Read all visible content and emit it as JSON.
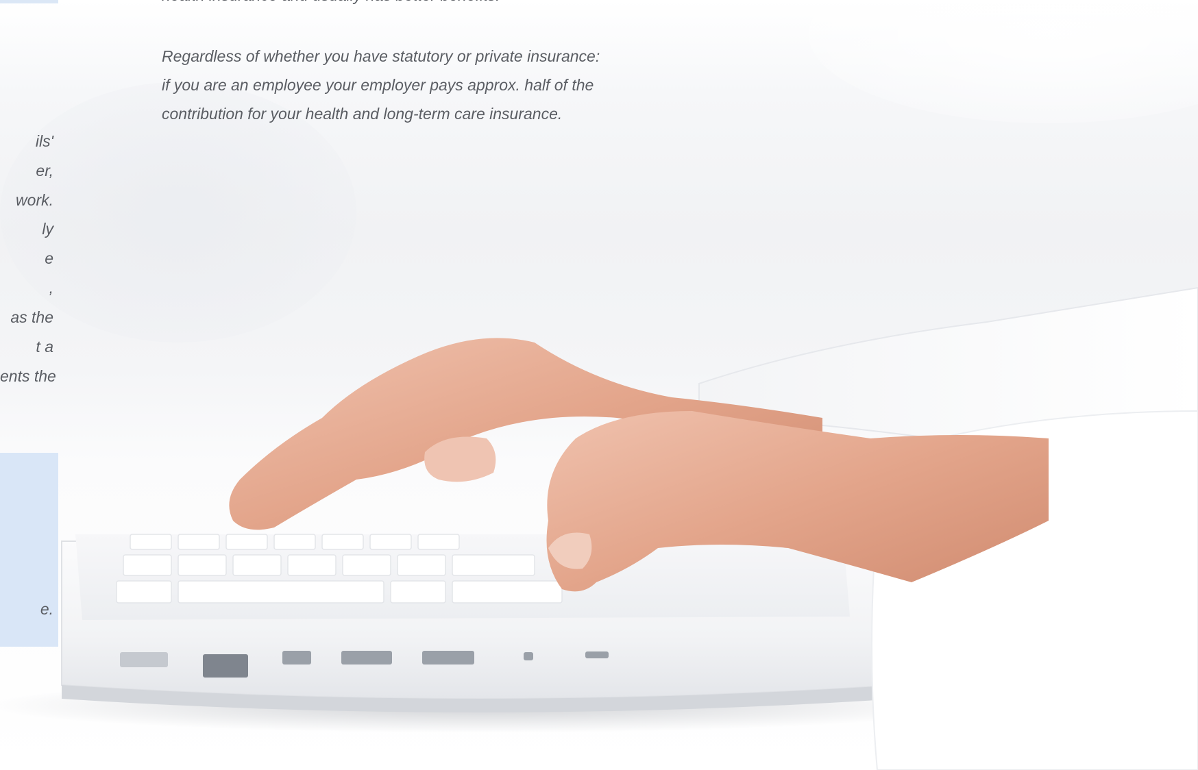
{
  "page": {
    "top_line": "health insurance and usually has better benefits.",
    "paragraph_lines": [
      "Regardless of whether you have statutory or private insurance:",
      "if you are an employee your employer pays approx. half of the",
      "contribution for your health and long-term care insurance."
    ],
    "left_column_fragments": [
      "ils'",
      "er,",
      "work.",
      "ly",
      "e",
      ",",
      "as the",
      "t a",
      "ents the"
    ],
    "blue_box_fragment": "e."
  },
  "photo": {
    "subject": "hands-typing-on-laptop"
  },
  "colors": {
    "text": "#5a5d63",
    "accent_box": "#d9e6f7",
    "skin": "#e7b09a"
  }
}
